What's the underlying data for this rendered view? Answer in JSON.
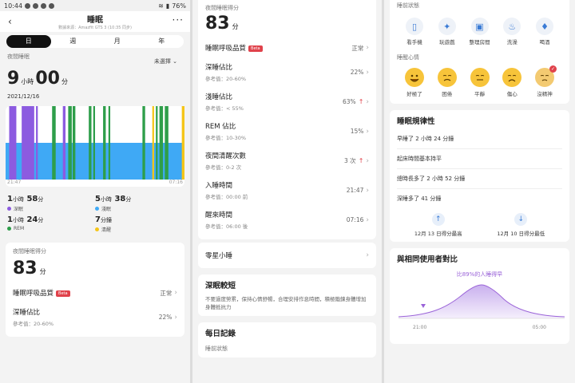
{
  "status": {
    "time": "10:44",
    "battery": "76%"
  },
  "header": {
    "title": "睡眠",
    "subtitle": "數據來源：Amazfit GTS 3 (10:35 同步)",
    "back": "‹",
    "more": "···"
  },
  "tabs": [
    {
      "label": "日",
      "active": true
    },
    {
      "label": "週"
    },
    {
      "label": "月"
    },
    {
      "label": "年"
    }
  ],
  "night_sleep": {
    "label": "夜間睡眠",
    "select_label": "未選擇",
    "hours": "9",
    "hours_unit": "小時",
    "minutes": "00",
    "minutes_unit": "分",
    "date": "2021/12/16",
    "start_time": "21:47",
    "end_time": "07:16"
  },
  "chart_data": {
    "type": "hypnogram",
    "start": "21:47",
    "end": "07:16",
    "stage_colors": {
      "deep": "#8c5be0",
      "light": "#3fa9f5",
      "rem": "#2e9e4a",
      "awake": "#f5c518"
    },
    "segments_fraction": [
      {
        "stage": "deep",
        "from": 0.02,
        "to": 0.06
      },
      {
        "stage": "deep",
        "from": 0.09,
        "to": 0.16
      },
      {
        "stage": "deep",
        "from": 0.17,
        "to": 0.18
      },
      {
        "stage": "rem",
        "from": 0.26,
        "to": 0.28
      },
      {
        "stage": "deep",
        "from": 0.32,
        "to": 0.335
      },
      {
        "stage": "rem",
        "from": 0.35,
        "to": 0.37
      },
      {
        "stage": "rem",
        "from": 0.375,
        "to": 0.39
      },
      {
        "stage": "rem",
        "from": 0.465,
        "to": 0.48
      },
      {
        "stage": "rem",
        "from": 0.49,
        "to": 0.5
      },
      {
        "stage": "rem",
        "from": 0.545,
        "to": 0.56
      },
      {
        "stage": "rem",
        "from": 0.575,
        "to": 0.585
      },
      {
        "stage": "rem",
        "from": 0.765,
        "to": 0.78
      },
      {
        "stage": "awake",
        "from": 0.82,
        "to": 0.83
      },
      {
        "stage": "rem",
        "from": 0.84,
        "to": 0.85
      },
      {
        "stage": "rem",
        "from": 0.86,
        "to": 0.88
      },
      {
        "stage": "rem",
        "from": 0.89,
        "to": 0.91
      },
      {
        "stage": "awake",
        "from": 0.985,
        "to": 1.0
      }
    ]
  },
  "stages": [
    {
      "h": "1",
      "h_unit": "小時",
      "m": "58",
      "m_unit": "分",
      "name": "深眠",
      "color": "#8c5be0"
    },
    {
      "h": "5",
      "h_unit": "小時",
      "m": "38",
      "m_unit": "分",
      "name": "淺眠",
      "color": "#3fa9f5"
    },
    {
      "h": "1",
      "h_unit": "小時",
      "m": "24",
      "m_unit": "分",
      "name": "REM",
      "color": "#2e9e4a"
    },
    {
      "h": "",
      "h_unit": "",
      "m": "7",
      "m_unit": "分鐘",
      "name": "清醒",
      "color": "#f5c518"
    }
  ],
  "score": {
    "label": "夜間睡眠得分",
    "value": "83",
    "unit": "分"
  },
  "breathing": {
    "label": "睡眠呼吸品質",
    "beta": "Beta",
    "value": "正常"
  },
  "metrics": [
    {
      "name": "深睡佔比",
      "ref": "參考值：20-60%",
      "value": "22%",
      "up": false
    },
    {
      "name": "淺睡佔比",
      "ref": "參考值：< 55%",
      "value": "63%",
      "up": true
    },
    {
      "name": "REM 佔比",
      "ref": "參考值：10-30%",
      "value": "15%",
      "up": false
    },
    {
      "name": "夜間清醒次數",
      "ref": "參考值：0-2 次",
      "value": "3 次",
      "up": true
    },
    {
      "name": "入睡時間",
      "ref": "參考值：00:00 前",
      "value": "21:47",
      "up": false
    },
    {
      "name": "醒來時間",
      "ref": "參考值：06:00 後",
      "value": "07:16",
      "up": false
    }
  ],
  "nap": {
    "label": "零星小睡"
  },
  "deep_short": {
    "title": "深眠較短",
    "desc": "不要過度勞累，保持心情舒暢，合理安排作息時間，積極鍛鍊身體增加身體抵抗力"
  },
  "daily": {
    "title": "每日記錄",
    "prestate": "睡前狀態"
  },
  "pre_state": {
    "label": "睡前狀態",
    "items": [
      {
        "label": "看手機",
        "icon": "phone-icon",
        "glyph": "▯"
      },
      {
        "label": "玩遊戲",
        "icon": "game-icon",
        "glyph": "✦"
      },
      {
        "label": "整理房間",
        "icon": "room-icon",
        "glyph": "▣"
      },
      {
        "label": "洗澡",
        "icon": "shower-icon",
        "glyph": "♨"
      },
      {
        "label": "喝酒",
        "icon": "drink-icon",
        "glyph": "♦"
      }
    ]
  },
  "mood": {
    "label": "睡醒心情",
    "items": [
      {
        "label": "好極了",
        "face": "smile"
      },
      {
        "label": "困倦",
        "face": "tired"
      },
      {
        "label": "平靜",
        "face": "calm"
      },
      {
        "label": "傷心",
        "face": "sad"
      },
      {
        "label": "沒精神",
        "face": "sleepy",
        "selected": true
      }
    ]
  },
  "regularity": {
    "title": "睡眠規律性",
    "rows": [
      "早睡了 2 小時 24 分鐘",
      "起床時間基本持平",
      "總時長多了 2 小時 52 分鐘",
      "深睡多了 41 分鐘"
    ],
    "best": "12月 13 日得分最高",
    "worst": "12月 10 日得分最低"
  },
  "compare": {
    "title": "與相同使用者對比",
    "note": "比89%的人睡得早",
    "x_start": "21:00",
    "x_end": "05:00"
  }
}
